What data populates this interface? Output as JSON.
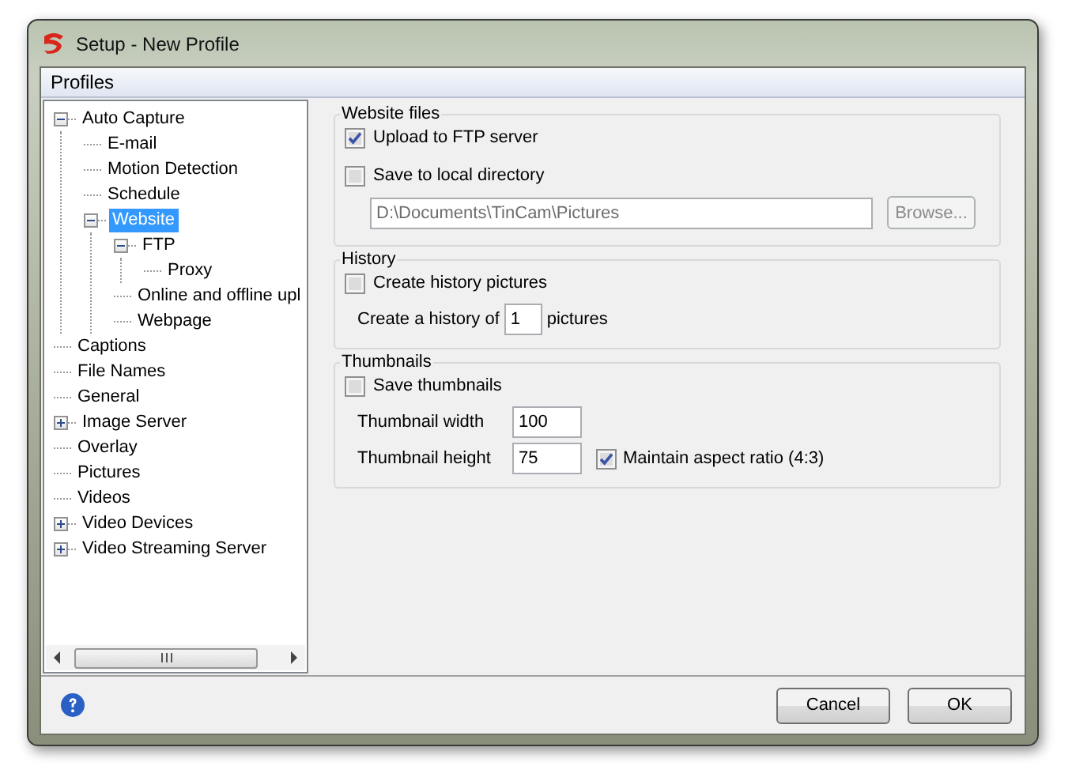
{
  "window": {
    "title": "Setup - New Profile"
  },
  "menu": [
    {
      "label": "Profiles"
    }
  ],
  "tree": [
    {
      "label": "Auto Capture",
      "expanded": true,
      "selected": false,
      "children": [
        {
          "label": "E-mail",
          "selected": false
        },
        {
          "label": "Motion Detection",
          "selected": false
        },
        {
          "label": "Schedule",
          "selected": false
        },
        {
          "label": "Website",
          "expanded": true,
          "selected": true,
          "children": [
            {
              "label": "FTP",
              "expanded": true,
              "selected": false,
              "children": [
                {
                  "label": "Proxy",
                  "selected": false
                }
              ]
            },
            {
              "label": "Online and offline upl",
              "selected": false
            },
            {
              "label": "Webpage",
              "selected": false
            }
          ]
        }
      ]
    },
    {
      "label": "Captions",
      "selected": false
    },
    {
      "label": "File Names",
      "selected": false
    },
    {
      "label": "General",
      "selected": false
    },
    {
      "label": "Image Server",
      "expanded": false,
      "selected": false
    },
    {
      "label": "Overlay",
      "selected": false
    },
    {
      "label": "Pictures",
      "selected": false
    },
    {
      "label": "Videos",
      "selected": false
    },
    {
      "label": "Video Devices",
      "expanded": false,
      "selected": false
    },
    {
      "label": "Video Streaming Server",
      "expanded": false,
      "selected": false
    }
  ],
  "groups": [
    {
      "title": "Website files",
      "rows": [
        {
          "kind": "checkbox",
          "label": "Upload to FTP server",
          "checked": true
        },
        {
          "kind": "checkbox",
          "label": "Save to local directory",
          "checked": false
        },
        {
          "kind": "path",
          "value": "D:\\Documents\\TinCam\\Pictures",
          "disabled": true,
          "button": "Browse...",
          "button_disabled": true
        }
      ]
    },
    {
      "title": "History",
      "rows": [
        {
          "kind": "checkbox",
          "label": "Create history pictures",
          "checked": false
        },
        {
          "kind": "count",
          "before": "Create a history of",
          "value": "1",
          "after": "pictures"
        }
      ]
    },
    {
      "title": "Thumbnails",
      "rows": [
        {
          "kind": "checkbox",
          "label": "Save thumbnails",
          "checked": false
        },
        {
          "kind": "field",
          "label": "Thumbnail width",
          "value": "100"
        },
        {
          "kind": "field",
          "label": "Thumbnail height",
          "value": "75",
          "checkbox": {
            "label": "Maintain aspect ratio (4:3)",
            "checked": true
          }
        }
      ]
    }
  ],
  "buttons": [
    {
      "label": "Cancel"
    },
    {
      "label": "OK"
    }
  ]
}
